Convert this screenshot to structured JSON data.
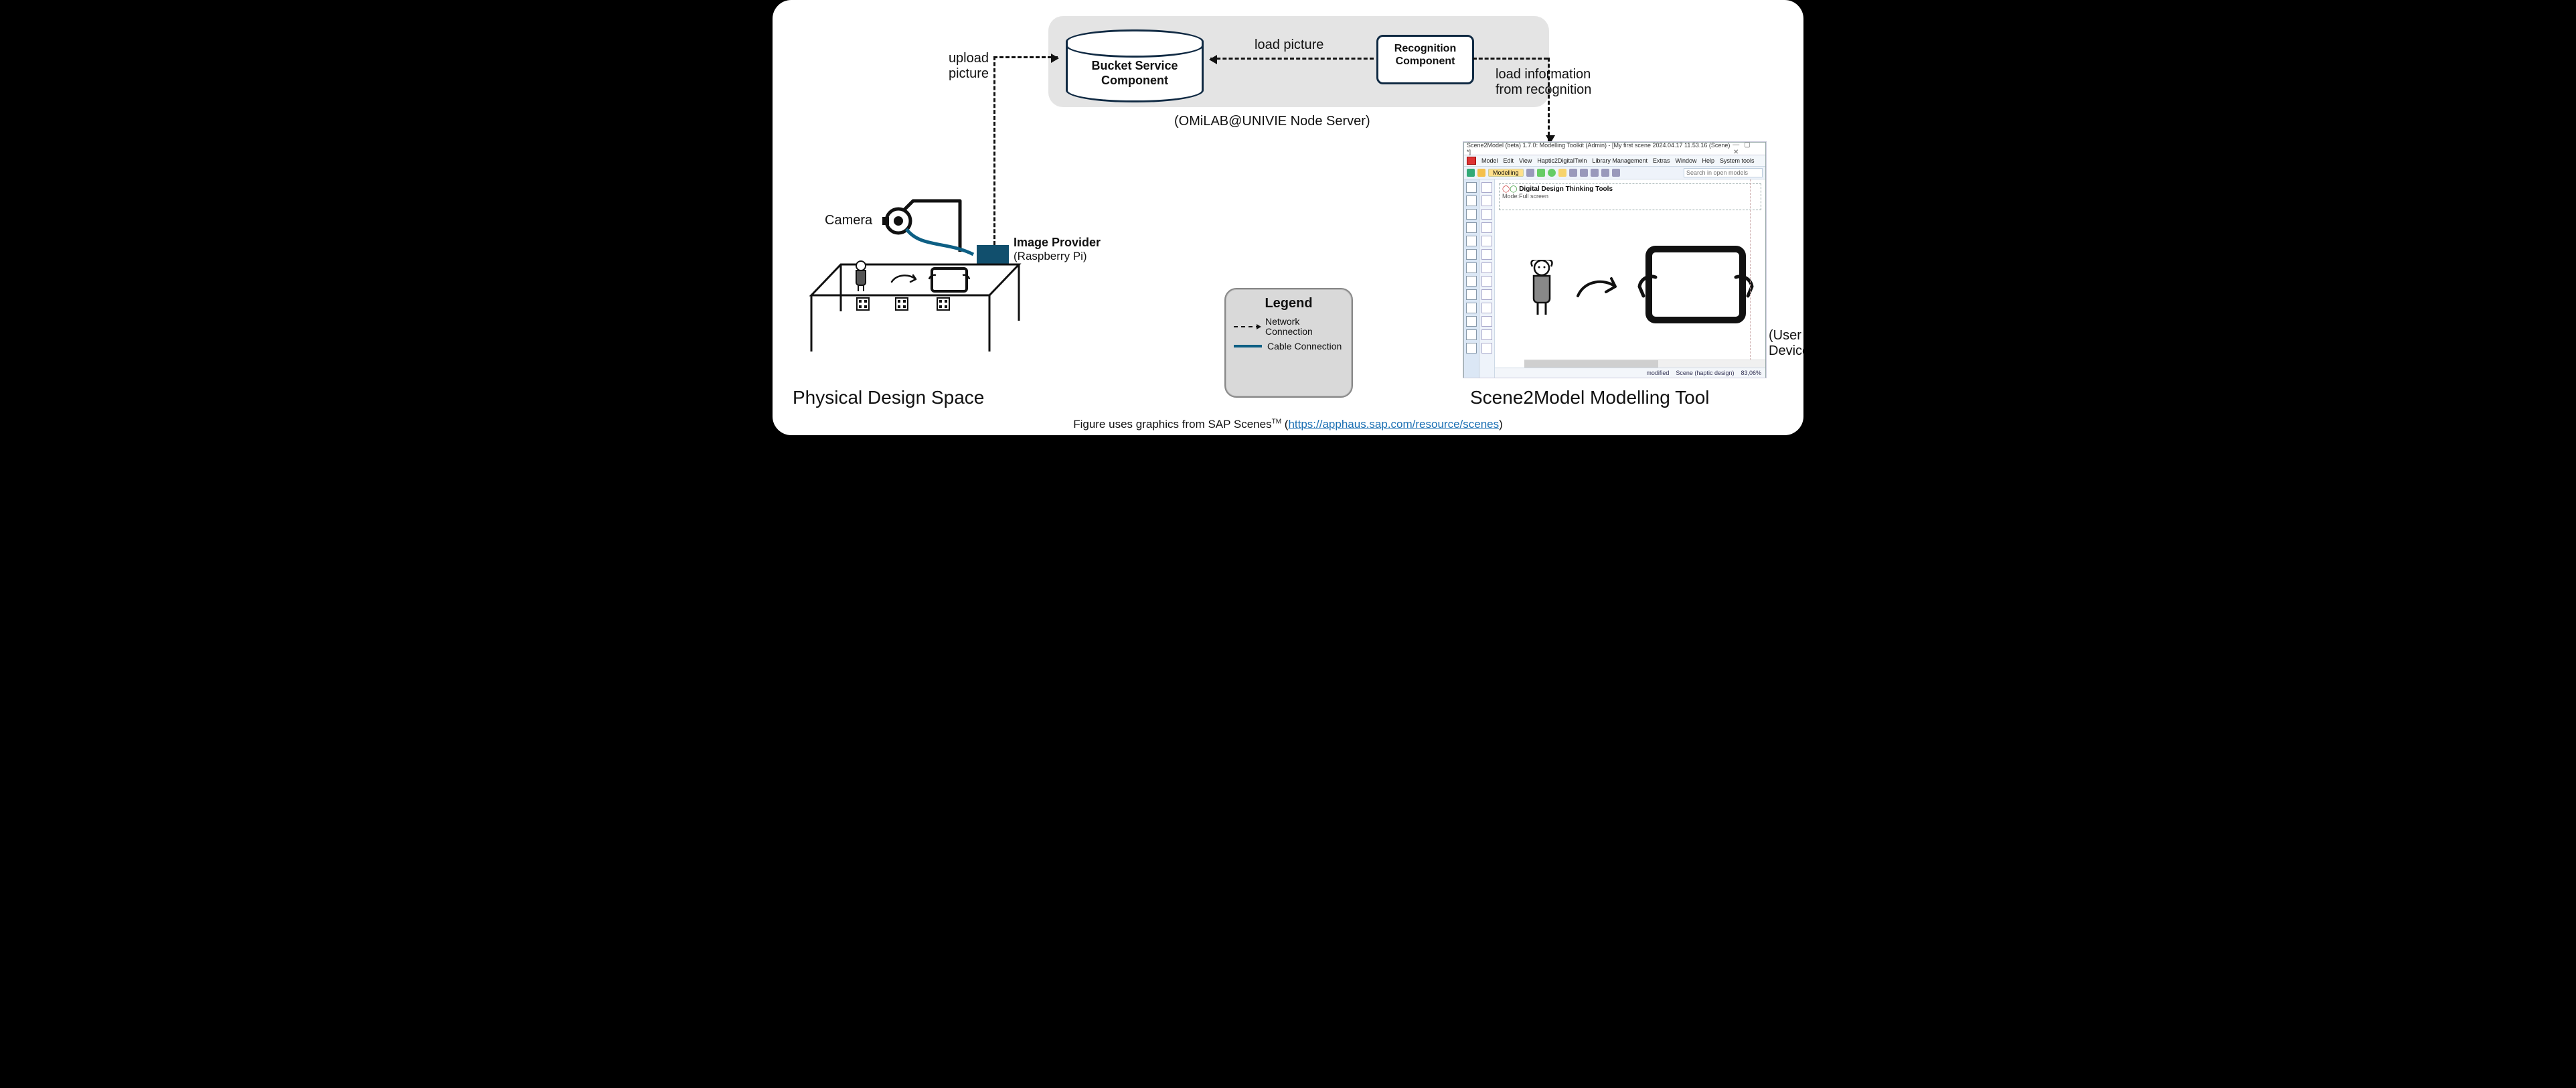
{
  "server": {
    "bucket_label_l1": "Bucket Service",
    "bucket_label_l2": "Component",
    "recognition_label_l1": "Recognition",
    "recognition_label_l2": "Component",
    "load_picture": "load picture",
    "subtitle": "(OMiLAB@UNIVIE Node Server)"
  },
  "left": {
    "upload_l1": "upload",
    "upload_l2": "picture",
    "camera": "Camera",
    "provider_title": "Image Provider",
    "provider_sub": "(Raspberry Pi)",
    "title": "Physical Design Space"
  },
  "right": {
    "load_info_l1": "load information",
    "load_info_l2": "from recognition",
    "user_device_l1": "(User",
    "user_device_l2": "Device)",
    "title": "Scene2Model Modelling Tool"
  },
  "legend": {
    "title": "Legend",
    "net": "Network Connection",
    "cable": "Cable Connection"
  },
  "app": {
    "title": "Scene2Model (beta) 1.7.0: Modelling Toolkit (Admin) - [My first scene 2024.04.17 11.53.16 (Scene) *]",
    "menu": [
      "Model",
      "Edit",
      "View",
      "Haptic2DigitalTwin",
      "Library Management",
      "Extras",
      "Window",
      "Help",
      "System tools"
    ],
    "toolbar_btn": "Modelling",
    "search_placeholder": "Search in open models",
    "canvas_title": "Digital Design Thinking Tools",
    "canvas_mode": "Mode:Full screen",
    "status_modified": "modified",
    "status_scene": "Scene (haptic design)",
    "status_pct": "83,06%"
  },
  "footer": {
    "prefix": "Figure uses graphics from SAP Scenes",
    "tm": "TM",
    "open": " (",
    "link": "https://apphaus.sap.com/resource/scenes",
    "close": ")"
  }
}
